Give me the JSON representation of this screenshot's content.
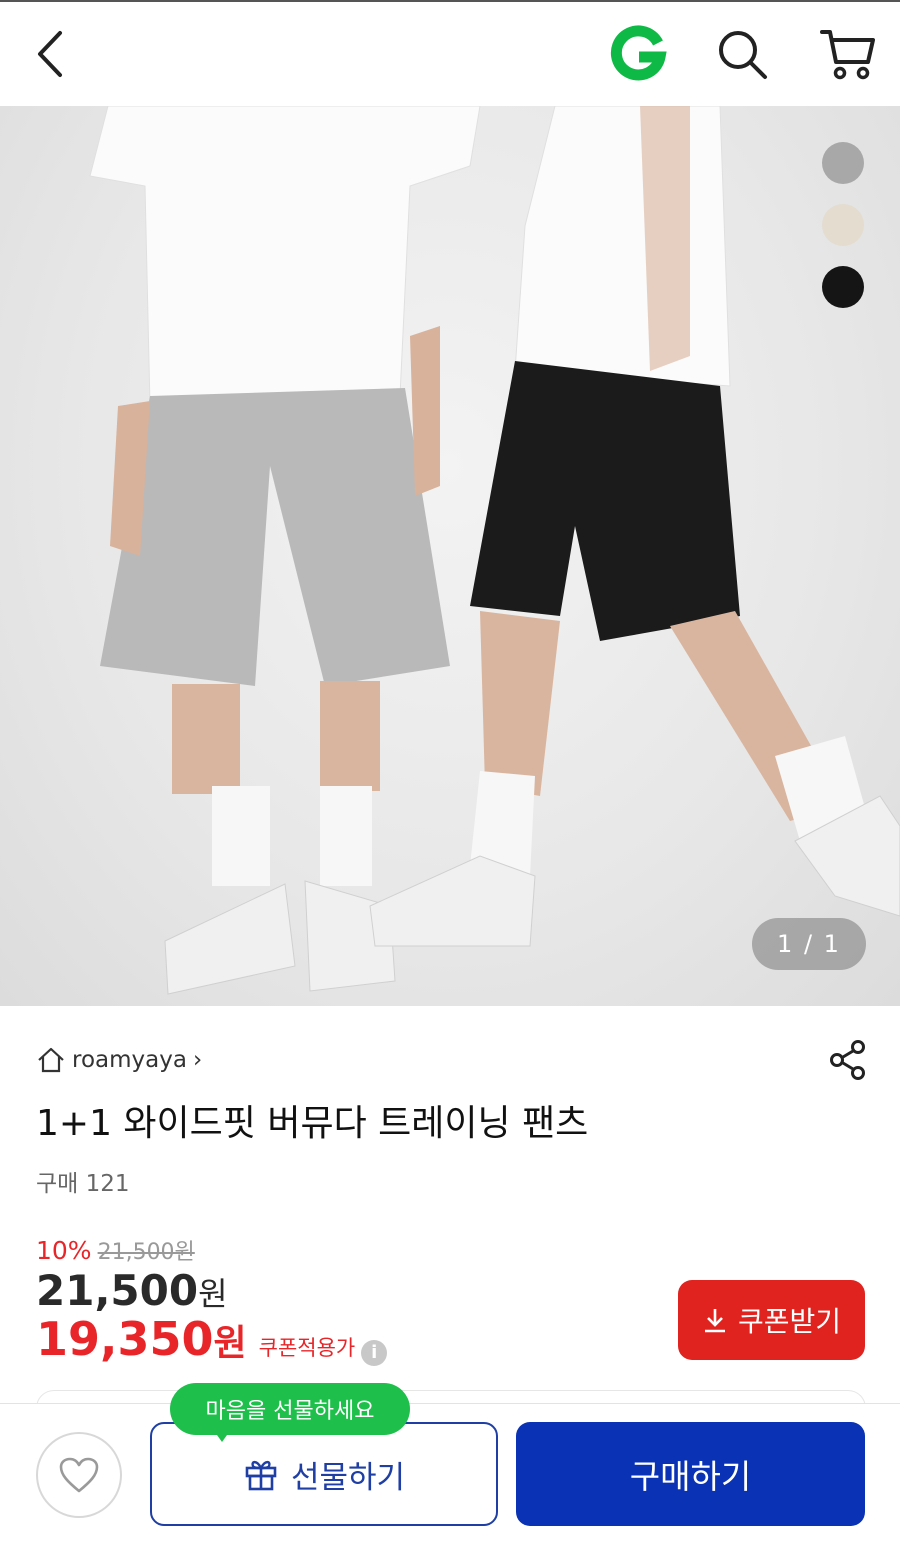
{
  "header": {
    "back_icon": "chevron-left-icon",
    "logo_letter": "G",
    "logo_color": "#0fb946",
    "search_icon": "search-icon",
    "cart_icon": "cart-icon"
  },
  "gallery": {
    "image_desc_icon": "product-photo",
    "swatches": [
      {
        "name": "gray",
        "color": "#a8a8a8"
      },
      {
        "name": "beige",
        "color": "#e3dccf"
      },
      {
        "name": "black",
        "color": "#151515"
      }
    ],
    "counter": "1 / 1"
  },
  "product": {
    "store_name": "roamyaya",
    "store_chevron": "›",
    "title": "1+1 와이드핏 버뮤다 트레이닝 팬츠",
    "purchase_count": "구매 121",
    "discount_percent": "10%",
    "original_price": "21,500원",
    "price": "21,500",
    "price_unit": "원",
    "sale_price": "19,350",
    "sale_unit": "원",
    "coupon_note": "쿠폰적용가",
    "info_icon": "i",
    "coupon_button": "쿠폰받기"
  },
  "bottom": {
    "gift_tooltip": "마음을 선물하세요",
    "gift_button": "선물하기",
    "buy_button": "구매하기"
  },
  "colors": {
    "accent_red": "#e8262a",
    "primary_blue": "#0a32b4",
    "green": "#1ec04b"
  }
}
